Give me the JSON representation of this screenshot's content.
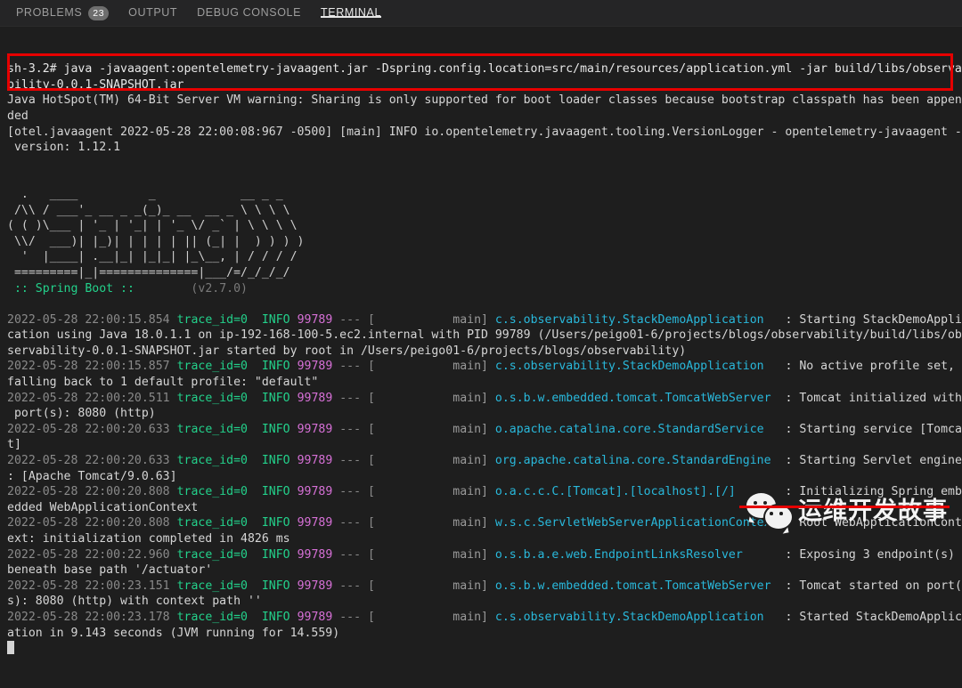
{
  "panel": {
    "tabs": [
      {
        "label": "PROBLEMS",
        "badge": "23",
        "active": false
      },
      {
        "label": "OUTPUT",
        "badge": "",
        "active": false
      },
      {
        "label": "DEBUG CONSOLE",
        "badge": "",
        "active": false
      },
      {
        "label": "TERMINAL",
        "badge": "",
        "active": true
      }
    ]
  },
  "colors": {
    "background": "#1e1e1e",
    "tabbar_background": "#252526",
    "annotation_red": "#e60000",
    "log_class_cyan": "#29b8db",
    "log_level_green": "#23d18b",
    "log_pid_magenta": "#d670d6",
    "log_timestamp_gray": "#8a8a8a",
    "text_default": "#d6d6d6"
  },
  "terminal": {
    "prompt": "sh-3.2#",
    "command": "java -javaagent:opentelemetry-javaagent.jar -Dspring.config.location=src/main/resources/application.yml -jar build/libs/observability-0.0.1-SNAPSHOT.jar",
    "command_line_1": "sh-3.2# java -javaagent:opentelemetry-javaagent.jar -Dspring.config.location=src/main/resources/application.yml -jar build/libs/observa",
    "command_line_2": "bility-0.0.1-SNAPSHOT.jar",
    "jvm_warning_line_1": "Java HotSpot(TM) 64-Bit Server VM warning: Sharing is only supported for boot loader classes because bootstrap classpath has been appen",
    "jvm_warning_line_2": "ded",
    "otel_line_1": "[otel.javaagent 2022-05-28 22:00:08:967 -0500] [main] INFO io.opentelemetry.javaagent.tooling.VersionLogger - opentelemetry-javaagent -",
    "otel_line_2": " version: 1.12.1",
    "banner_lines": [
      "  .   ____          _            __ _ _",
      " /\\\\ / ___'_ __ _ _(_)_ __  __ _ \\ \\ \\ \\",
      "( ( )\\___ | '_ | '_| | '_ \\/ _` | \\ \\ \\ \\",
      " \\\\/  ___)| |_)| | | | | || (_| |  ) ) ) )",
      "  '  |____| .__|_| |_|_| |_\\__, | / / / /",
      " =========|_|==============|___/=/_/_/_/"
    ],
    "banner_footer_left": " :: Spring Boot :: ",
    "banner_footer_version": "       (v2.7.0)",
    "cursor": "block",
    "log_entries": [
      {
        "timestamp": "2022-05-28 22:00:15.854",
        "trace_id": "trace_id=0",
        "level": "INFO",
        "pid": "99789",
        "separator": "--- [",
        "thread": "           main]",
        "logger": "c.s.observability.StackDemoApplication",
        "logger_pad": "   ",
        "message": ": Starting StackDemoAppli",
        "wrapped": [
          "cation using Java 18.0.1.1 on ip-192-168-100-5.ec2.internal with PID 99789 (/Users/peigo01-6/projects/blogs/observability/build/libs/ob",
          "servability-0.0.1-SNAPSHOT.jar started by root in /Users/peigo01-6/projects/blogs/observability)"
        ]
      },
      {
        "timestamp": "2022-05-28 22:00:15.857",
        "trace_id": "trace_id=0",
        "level": "INFO",
        "pid": "99789",
        "separator": "--- [",
        "thread": "           main]",
        "logger": "c.s.observability.StackDemoApplication",
        "logger_pad": "   ",
        "message": ": No active profile set,",
        "wrapped": [
          "falling back to 1 default profile: \"default\""
        ]
      },
      {
        "timestamp": "2022-05-28 22:00:20.511",
        "trace_id": "trace_id=0",
        "level": "INFO",
        "pid": "99789",
        "separator": "--- [",
        "thread": "           main]",
        "logger": "o.s.b.w.embedded.tomcat.TomcatWebServer",
        "logger_pad": "  ",
        "message": ": Tomcat initialized with",
        "wrapped": [
          " port(s): 8080 (http)"
        ]
      },
      {
        "timestamp": "2022-05-28 22:00:20.633",
        "trace_id": "trace_id=0",
        "level": "INFO",
        "pid": "99789",
        "separator": "--- [",
        "thread": "           main]",
        "logger": "o.apache.catalina.core.StandardService",
        "logger_pad": "   ",
        "message": ": Starting service [Tomca",
        "wrapped": [
          "t]"
        ]
      },
      {
        "timestamp": "2022-05-28 22:00:20.633",
        "trace_id": "trace_id=0",
        "level": "INFO",
        "pid": "99789",
        "separator": "--- [",
        "thread": "           main]",
        "logger": "org.apache.catalina.core.StandardEngine",
        "logger_pad": "  ",
        "message": ": Starting Servlet engine",
        "wrapped": [
          ": [Apache Tomcat/9.0.63]"
        ]
      },
      {
        "timestamp": "2022-05-28 22:00:20.808",
        "trace_id": "trace_id=0",
        "level": "INFO",
        "pid": "99789",
        "separator": "--- [",
        "thread": "           main]",
        "logger": "o.a.c.c.C.[Tomcat].[localhost].[/]",
        "logger_pad": "       ",
        "message": ": Initializing Spring emb",
        "wrapped": [
          "edded WebApplicationContext"
        ]
      },
      {
        "timestamp": "2022-05-28 22:00:20.808",
        "trace_id": "trace_id=0",
        "level": "INFO",
        "pid": "99789",
        "separator": "--- [",
        "thread": "           main]",
        "logger": "w.s.c.ServletWebServerApplicationContext",
        "logger_pad": " ",
        "message": ": Root WebApplicationCont",
        "wrapped": [
          "ext: initialization completed in 4826 ms"
        ]
      },
      {
        "timestamp": "2022-05-28 22:00:22.960",
        "trace_id": "trace_id=0",
        "level": "INFO",
        "pid": "99789",
        "separator": "--- [",
        "thread": "           main]",
        "logger": "o.s.b.a.e.web.EndpointLinksResolver",
        "logger_pad": "      ",
        "message": ": Exposing 3 endpoint(s)",
        "wrapped": [
          "beneath base path '/actuator'"
        ]
      },
      {
        "timestamp": "2022-05-28 22:00:23.151",
        "trace_id": "trace_id=0",
        "level": "INFO",
        "pid": "99789",
        "separator": "--- [",
        "thread": "           main]",
        "logger": "o.s.b.w.embedded.tomcat.TomcatWebServer",
        "logger_pad": "  ",
        "message": ": Tomcat started on port(",
        "wrapped": [
          "s): 8080 (http) with context path ''"
        ]
      },
      {
        "timestamp": "2022-05-28 22:00:23.178",
        "trace_id": "trace_id=0",
        "level": "INFO",
        "pid": "99789",
        "separator": "--- [",
        "thread": "           main]",
        "logger": "c.s.observability.StackDemoApplication",
        "logger_pad": "   ",
        "message": ": Started StackDemoApplic",
        "wrapped": [
          "ation in 9.143 seconds (JVM running for 14.559)"
        ]
      }
    ]
  },
  "watermark": {
    "icon": "wechat-icon",
    "text": "运维开发故事"
  }
}
